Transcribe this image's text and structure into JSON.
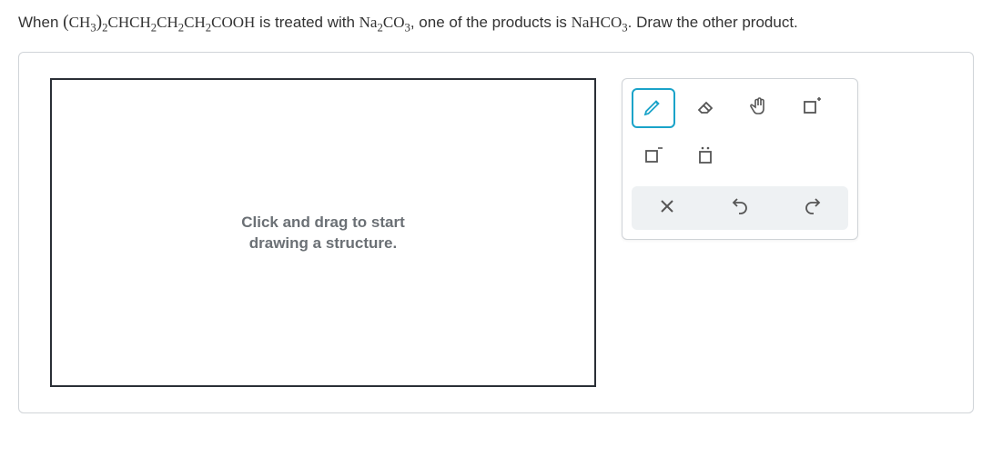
{
  "question": {
    "prefix": "When ",
    "reactant_display": "(CH3)2CHCH2CH2CH2COOH",
    "mid1": " is treated with ",
    "reagent_display": "Na2CO3",
    "mid2": ", one of the products is ",
    "product1_display": "NaHCO3",
    "suffix": ". Draw the other product."
  },
  "canvas": {
    "hint_line1": "Click and drag to start",
    "hint_line2": "drawing a structure."
  },
  "toolbox": {
    "row1": [
      "pencil",
      "eraser",
      "hand",
      "box-plus"
    ],
    "row2": [
      "box-minus",
      "box-dots"
    ],
    "row3_actions": [
      "clear",
      "undo",
      "redo"
    ]
  }
}
